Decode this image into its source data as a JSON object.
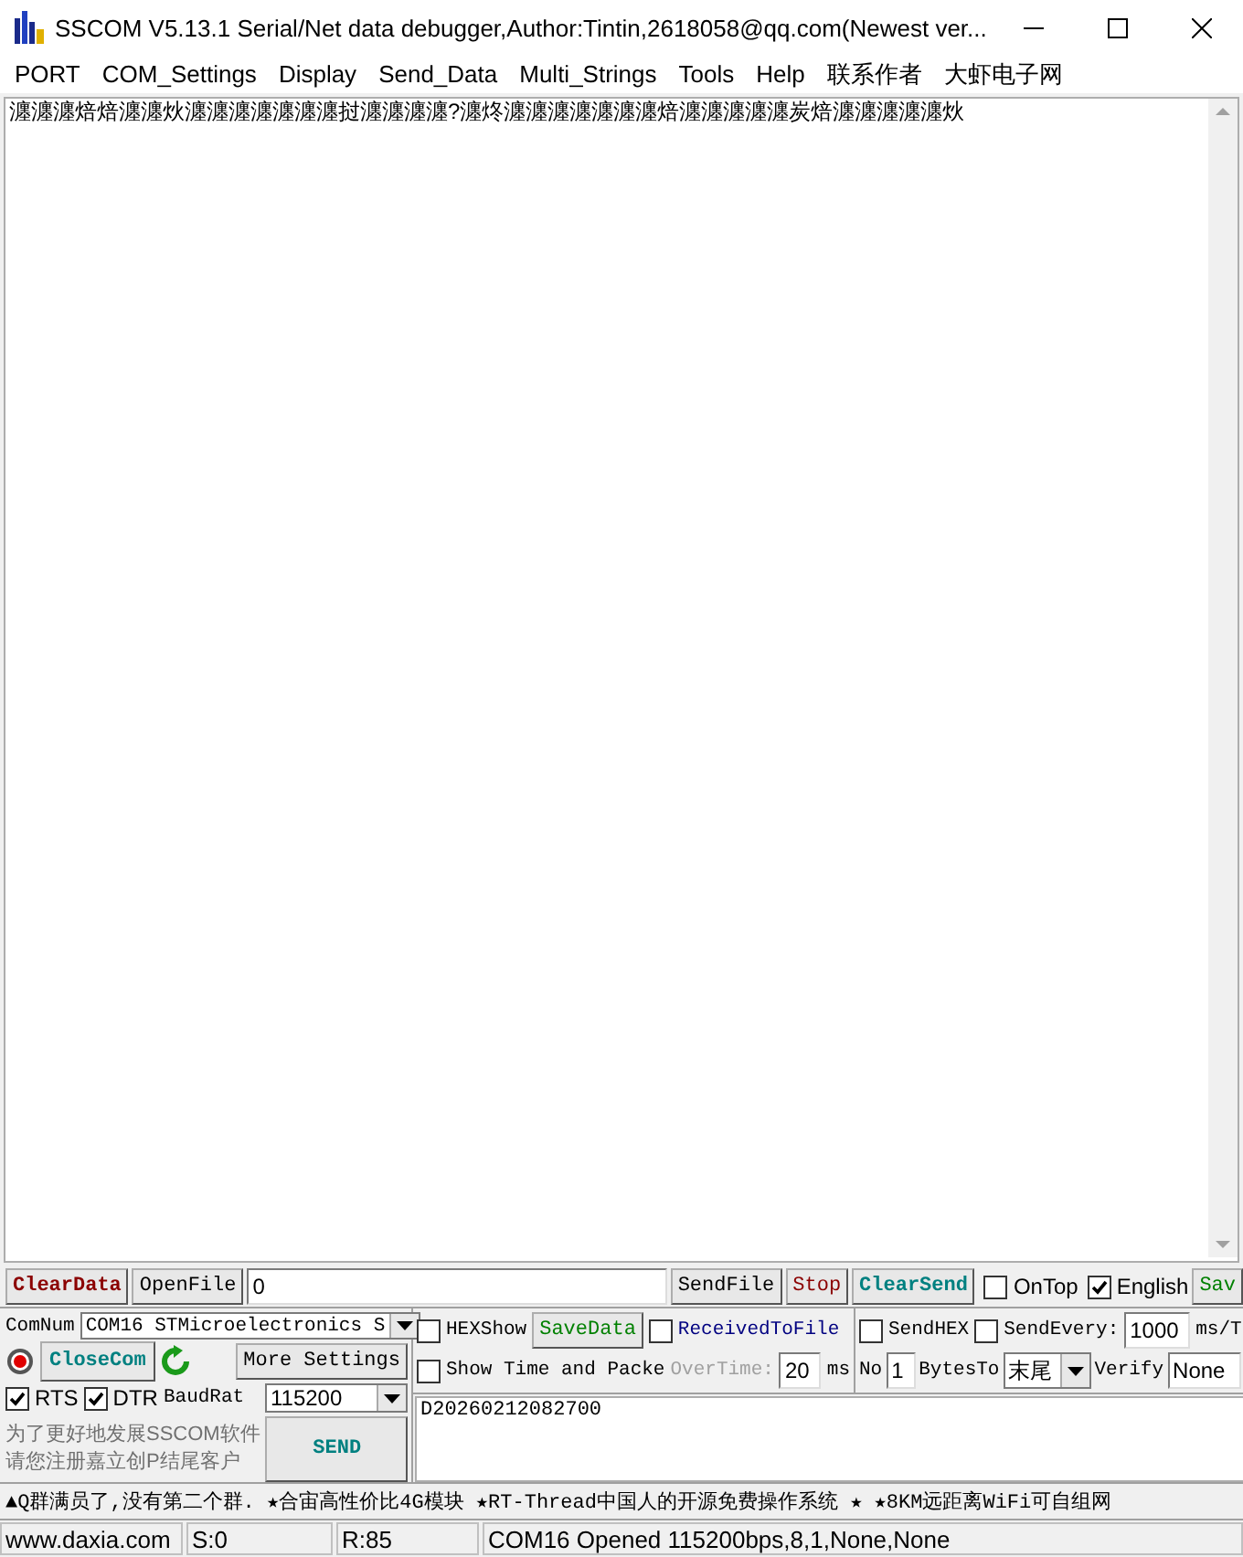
{
  "window": {
    "title": "SSCOM V5.13.1 Serial/Net data debugger,Author:Tintin,2618058@qq.com(Newest ver..."
  },
  "menu": [
    "PORT",
    "COM_Settings",
    "Display",
    "Send_Data",
    "Multi_Strings",
    "Tools",
    "Help",
    "联系作者",
    "大虾电子网"
  ],
  "receive_area": {
    "text": "瀍瀍瀍焙焙瀍瀍炏瀍瀍瀍瀍瀍瀍瀍挝瀍瀍瀍瀍?瀍炵瀍瀍瀍瀍瀍瀍瀍焙瀍瀍瀍瀍瀍炭焙瀍瀍瀍瀍瀍炏"
  },
  "toolbar": {
    "clear_data": "ClearData",
    "open_file": "OpenFile",
    "file_path": "0",
    "send_file": "SendFile",
    "stop": "Stop",
    "clear_send": "ClearSend",
    "checks": [
      {
        "label": "OnTop",
        "checked": false
      },
      {
        "label": "English",
        "checked": true
      }
    ],
    "save_config": "Sav"
  },
  "port_panel": {
    "com_label": "ComNum",
    "com_port": "COM16 STMicroelectronics S",
    "close_com": "CloseCom",
    "port_open": true,
    "more_settings": "More Settings",
    "lines": [
      {
        "label": "RTS",
        "checked": true
      },
      {
        "label": "DTR",
        "checked": true
      }
    ],
    "baud_label": "BaudRat",
    "baud_rate": "115200",
    "promo": [
      "为了更好地发展SSCOM软件",
      "请您注册嘉立创P结尾客户"
    ],
    "send": "SEND"
  },
  "receive_options": {
    "hex_show": {
      "label": "HEXShow",
      "checked": false
    },
    "save_data": "SaveData",
    "received_to_file": {
      "label": "ReceivedToFile",
      "checked": false
    },
    "show_time": {
      "label": "Show Time and Packe",
      "checked": false
    },
    "overtime_label": "OverTime:",
    "overtime": "20",
    "overtime_unit": "ms"
  },
  "send_options": {
    "send_hex": {
      "label": "SendHEX",
      "checked": false
    },
    "send_every": {
      "label": "SendEvery:",
      "checked": false
    },
    "interval": "1000",
    "interval_unit": "ms/T",
    "no_label": "No",
    "no": "1",
    "bytes_to_label": "BytesTo",
    "bytes_to": "末尾",
    "verify_label": "Verify",
    "verify": "None"
  },
  "send_text": "D20260212082700",
  "marquee": "▲Q群满员了,没有第二个群. ★合宙高性价比4G模块 ★RT-Thread中国人的开源免费操作系统 ★ ★8KM远距离WiFi可自组网",
  "status_bar": [
    "www.daxia.com",
    "S:0",
    "R:85",
    "COM16 Opened  115200bps,8,1,None,None"
  ]
}
